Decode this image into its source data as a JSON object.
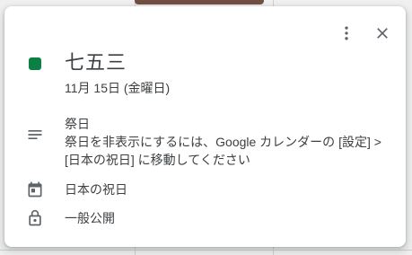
{
  "event": {
    "title": "七五三",
    "date": "11月 15日 (金曜日)",
    "color": "#0b8043",
    "description_lines": [
      "祭日",
      "祭日を非表示にするには、Google カレンダーの [設定] >",
      "[日本の祝日] に移動してください"
    ],
    "calendar": "日本の祝日",
    "visibility": "一般公開"
  },
  "icons": {
    "more": "more-vert-icon",
    "close": "close-icon",
    "description": "notes-icon",
    "calendar": "calendar-icon",
    "visibility": "lock-icon"
  },
  "colors": {
    "background_event": "#795548",
    "text": "#3c4043",
    "icon": "#5f6368"
  }
}
